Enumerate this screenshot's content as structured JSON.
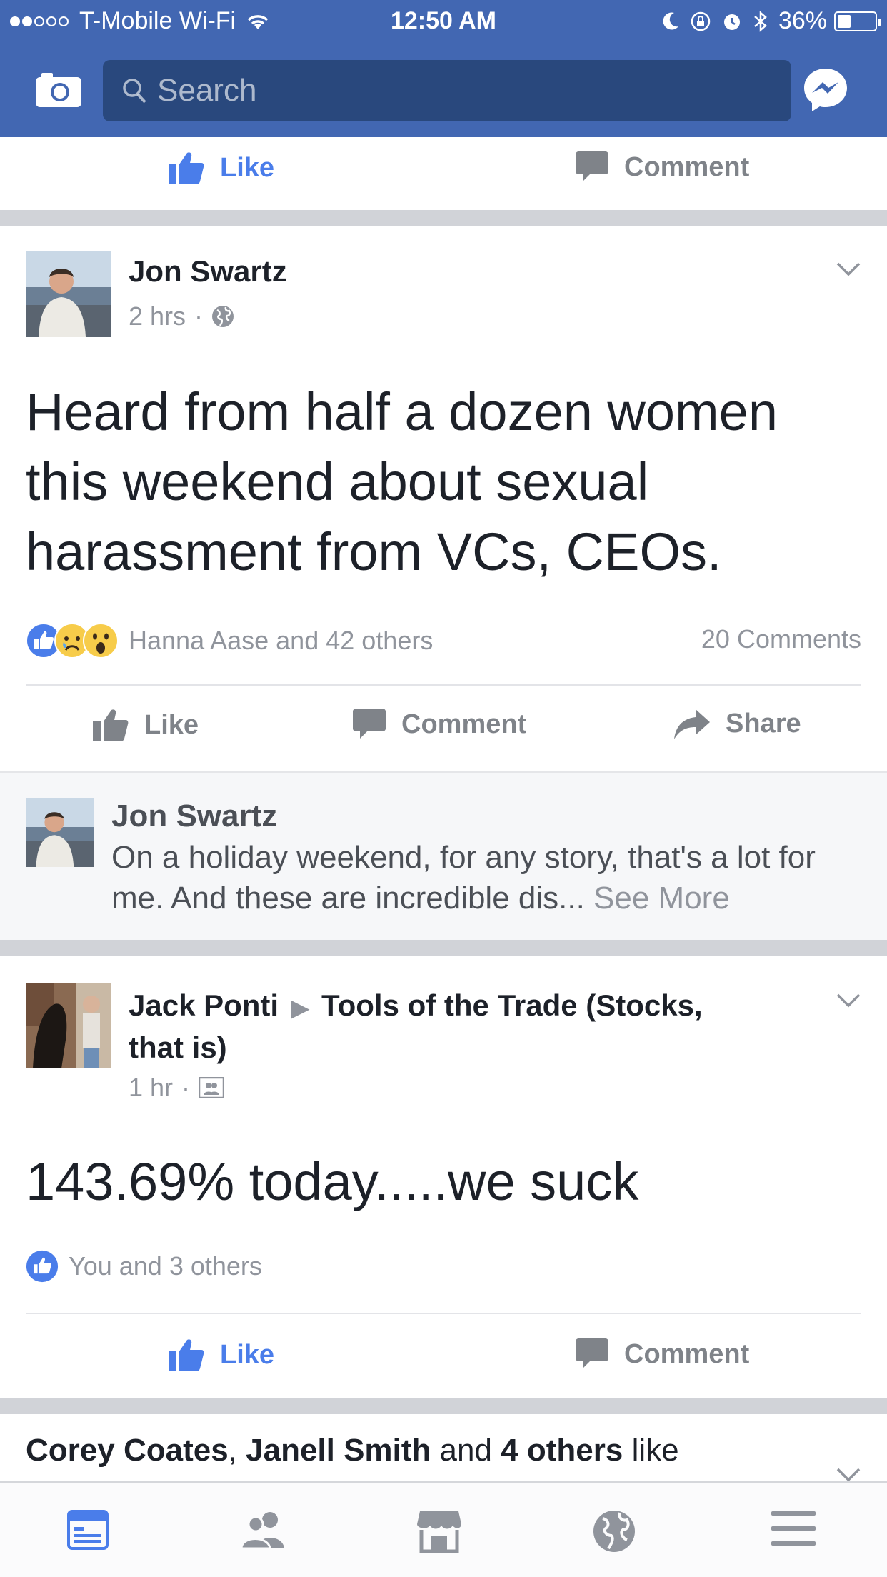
{
  "status_bar": {
    "carrier": "T-Mobile Wi-Fi",
    "time": "12:50 AM",
    "battery": "36%",
    "battery_level": 0.36
  },
  "header": {
    "search_placeholder": "Search",
    "icons": [
      "camera-icon",
      "search-icon",
      "messenger-icon"
    ]
  },
  "previous_post_actions": {
    "like": "Like",
    "comment": "Comment"
  },
  "post1": {
    "author": "Jon Swartz",
    "time": "2 hrs",
    "separator": "·",
    "privacy_icon": "globe-icon",
    "text_lines": [
      "Heard from half a dozen women",
      "this weekend about sexual",
      "harassment from VCs, CEOs."
    ],
    "reactions": [
      "like",
      "sad",
      "wow"
    ],
    "reactions_text": "Hanna Aase and 42 others",
    "comments_count": "20 Comments",
    "actions": {
      "like": "Like",
      "comment": "Comment",
      "share": "Share"
    },
    "top_comment": {
      "author": "Jon Swartz",
      "text": "On a holiday weekend, for any story, that's a lot for me. And these are incredible dis... ",
      "see_more": "See More"
    }
  },
  "post2": {
    "author": "Jack Ponti",
    "arrow": "▶",
    "group_line1": "Tools of the Trade (Stocks,",
    "group_line2": "that is)",
    "time": "1 hr",
    "separator": "·",
    "privacy_icon": "group-icon",
    "text": "143.69% today.....we suck",
    "reactions_text": "You and 3 others",
    "actions": {
      "like": "Like",
      "comment": "Comment"
    }
  },
  "post3": {
    "name1": "Corey Coates",
    "comma": ", ",
    "name2": "Janell Smith",
    "and": " and ",
    "others": "4 others",
    "like": " like"
  },
  "tab_bar": {
    "tabs": [
      "news-feed-icon",
      "friends-icon",
      "marketplace-icon",
      "notifications-globe-icon",
      "menu-icon"
    ],
    "active": "news-feed-icon"
  },
  "colors": {
    "brand_blue": "#4267b2",
    "search_bg": "#29487d",
    "link_blue": "#4a7dea",
    "text_dark": "#1d2129",
    "text_gray": "#90949c"
  }
}
